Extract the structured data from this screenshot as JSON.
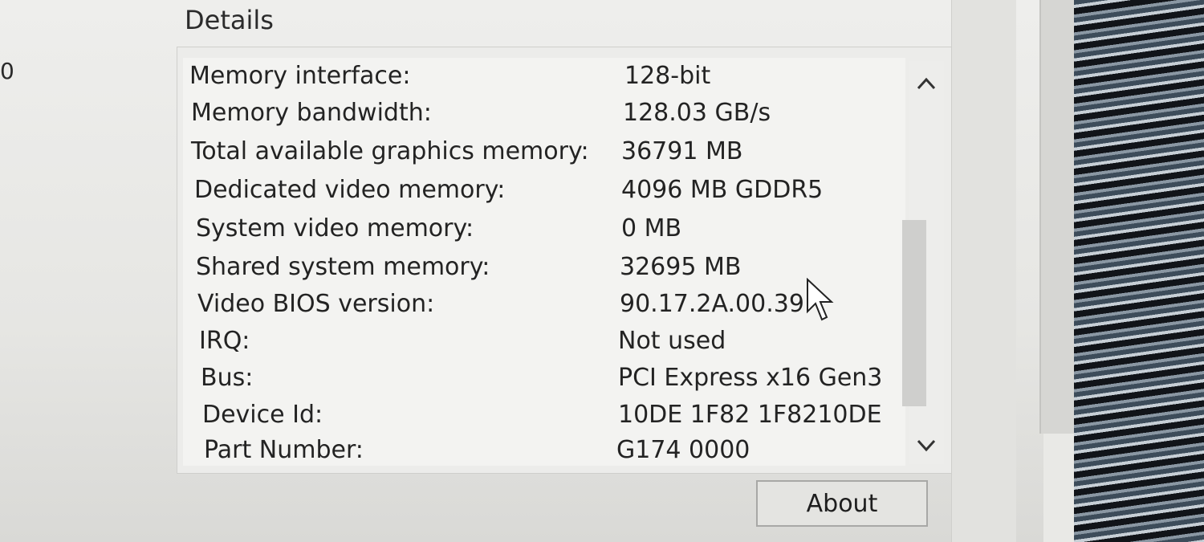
{
  "left_edge_text": "0",
  "details": {
    "title": "Details",
    "rows": [
      {
        "label": "Memory interface:",
        "value": "128-bit"
      },
      {
        "label": "Memory bandwidth:",
        "value": "128.03 GB/s"
      },
      {
        "label": "Total available graphics memory:",
        "value": "36791 MB"
      },
      {
        "label": "Dedicated video memory:",
        "value": "4096 MB GDDR5"
      },
      {
        "label": "System video memory:",
        "value": "0 MB"
      },
      {
        "label": "Shared system memory:",
        "value": "32695 MB"
      },
      {
        "label": "Video BIOS version:",
        "value": "90.17.2A.00.39"
      },
      {
        "label": "IRQ:",
        "value": "Not used"
      },
      {
        "label": "Bus:",
        "value": "PCI Express x16 Gen3"
      },
      {
        "label": "Device Id:",
        "value": "10DE 1F82 1F8210DE"
      },
      {
        "label": "Part Number:",
        "value": "G174 0000"
      }
    ]
  },
  "scrollbar": {
    "up_icon": "chevron-up-icon",
    "down_icon": "chevron-down-icon"
  },
  "buttons": {
    "about_label": "About"
  }
}
